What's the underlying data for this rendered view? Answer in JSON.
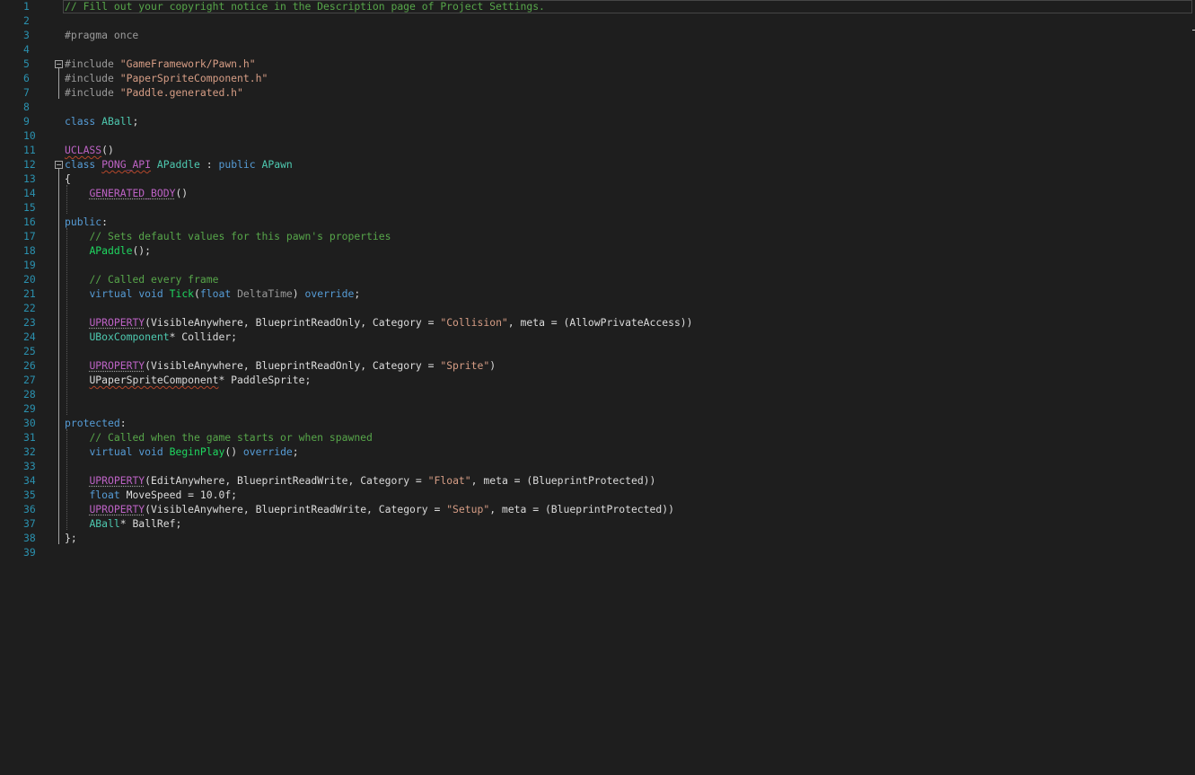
{
  "editor": {
    "language": "C++",
    "colors": {
      "background": "#1e1e1e",
      "line_number": "#2b91af",
      "keyword": "#569cd6",
      "string": "#d69d85",
      "type": "#4ec9b0",
      "function": "#1ed760",
      "macro": "#bd63c5",
      "comment": "#57a64a",
      "preprocessor": "#9b9b9b",
      "plain": "#dcdcdc"
    },
    "line_numbers": [
      "1",
      "2",
      "3",
      "4",
      "5",
      "6",
      "7",
      "8",
      "9",
      "10",
      "11",
      "12",
      "13",
      "14",
      "15",
      "16",
      "17",
      "18",
      "19",
      "20",
      "21",
      "22",
      "23",
      "24",
      "25",
      "26",
      "27",
      "28",
      "29",
      "30",
      "31",
      "32",
      "33",
      "34",
      "35",
      "36",
      "37",
      "38",
      "39"
    ],
    "lines": [
      [
        "// Fill out your copyright notice in the Description page of Project Settings."
      ],
      [],
      [
        "#pragma once"
      ],
      [],
      [
        "#include ",
        "\"GameFramework/Pawn.h\""
      ],
      [
        "#include ",
        "\"PaperSpriteComponent.h\""
      ],
      [
        "#include ",
        "\"Paddle.generated.h\""
      ],
      [],
      [
        "class",
        " ",
        "ABall",
        ";"
      ],
      [],
      [
        "UCLASS",
        "()"
      ],
      [
        "class",
        " ",
        "PONG_API",
        " ",
        "APaddle",
        " : ",
        "public",
        " ",
        "APawn"
      ],
      [
        "{"
      ],
      [
        "    ",
        "GENERATED_BODY",
        "()"
      ],
      [],
      [
        "public",
        ":"
      ],
      [
        "    ",
        "// Sets default values for this pawn's properties"
      ],
      [
        "    ",
        "APaddle",
        "();"
      ],
      [],
      [
        "    ",
        "// Called every frame"
      ],
      [
        "    ",
        "virtual",
        " ",
        "void",
        " ",
        "Tick",
        "(",
        "float",
        " ",
        "DeltaTime",
        ") ",
        "override",
        ";"
      ],
      [],
      [
        "    ",
        "UPROPERTY",
        "(VisibleAnywhere, BlueprintReadOnly, Category = ",
        "\"Collision\"",
        ", meta = (AllowPrivateAccess))"
      ],
      [
        "    ",
        "UBoxComponent",
        "* Collider;"
      ],
      [],
      [
        "    ",
        "UPROPERTY",
        "(VisibleAnywhere, BlueprintReadOnly, Category = ",
        "\"Sprite\"",
        ")"
      ],
      [
        "    ",
        "UPaperSpriteComponent",
        "* PaddleSprite;"
      ],
      [],
      [],
      [
        "protected",
        ":"
      ],
      [
        "    ",
        "// Called when the game starts or when spawned"
      ],
      [
        "    ",
        "virtual",
        " ",
        "void",
        " ",
        "BeginPlay",
        "() ",
        "override",
        ";"
      ],
      [],
      [
        "    ",
        "UPROPERTY",
        "(EditAnywhere, BlueprintReadWrite, Category = ",
        "\"Float\"",
        ", meta = (BlueprintProtected))"
      ],
      [
        "    ",
        "float",
        " MoveSpeed = 10.0f;"
      ],
      [
        "    ",
        "UPROPERTY",
        "(VisibleAnywhere, BlueprintReadWrite, Category = ",
        "\"Setup\"",
        ", meta = (BlueprintProtected))"
      ],
      [
        "    ",
        "ABall",
        "* BallRef;"
      ],
      [
        "};"
      ],
      []
    ]
  }
}
